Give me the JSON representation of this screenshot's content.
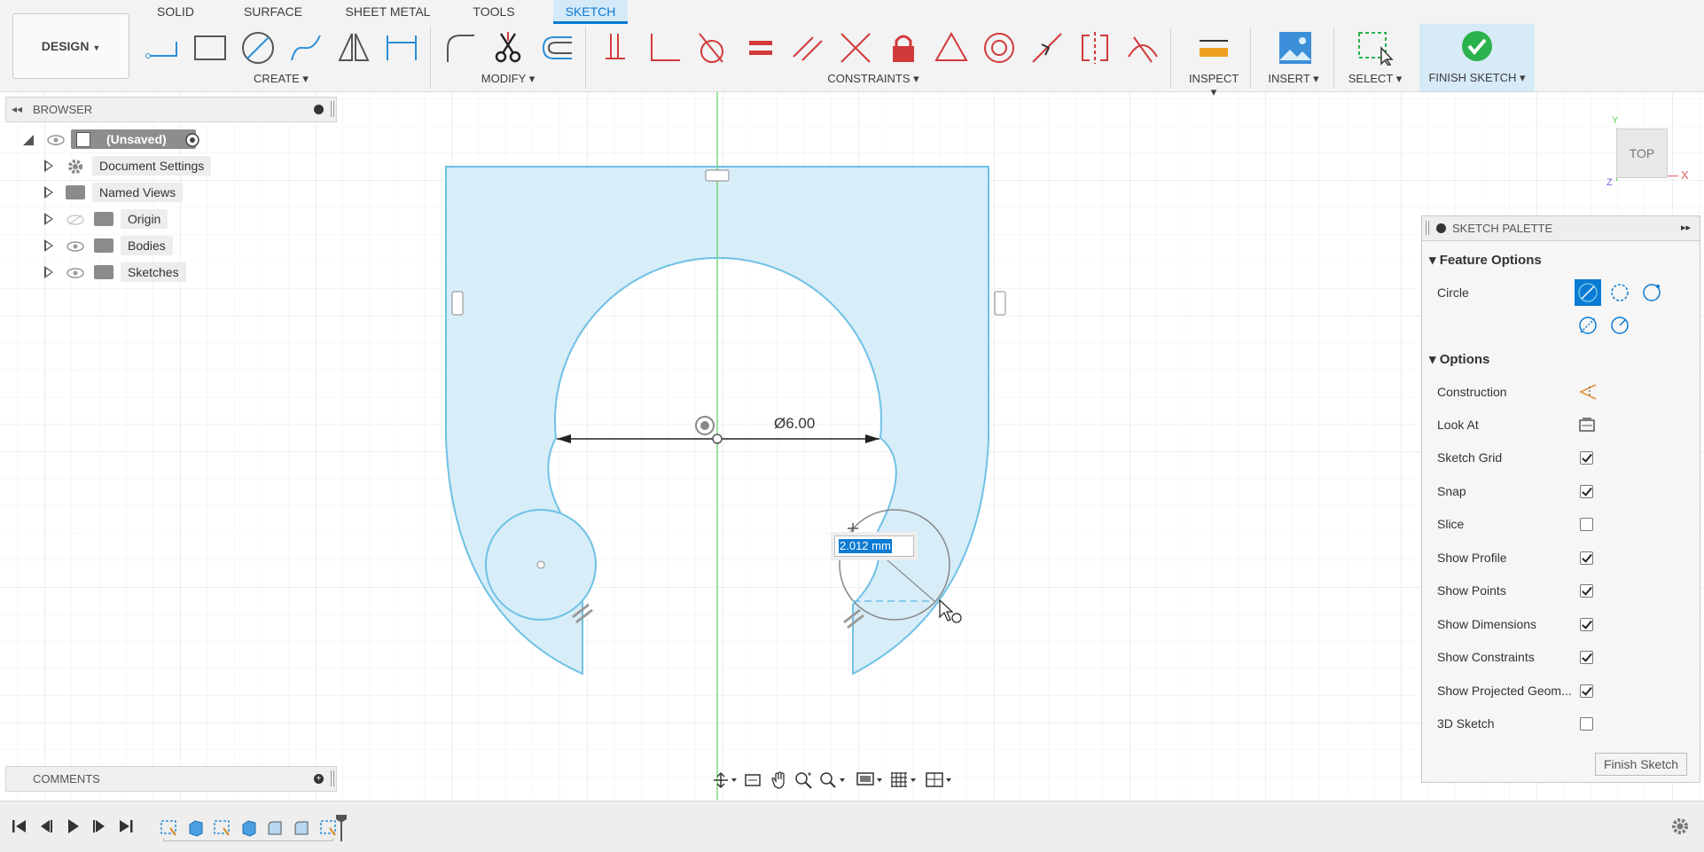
{
  "tabs": [
    "SOLID",
    "SURFACE",
    "SHEET METAL",
    "TOOLS",
    "SKETCH"
  ],
  "workspace_button": "DESIGN",
  "groups": {
    "create": "CREATE",
    "modify": "MODIFY",
    "constraints": "CONSTRAINTS",
    "inspect": "INSPECT",
    "insert": "INSERT",
    "select": "SELECT",
    "finish": "FINISH SKETCH"
  },
  "browser": {
    "title": "BROWSER",
    "root": "(Unsaved)",
    "items": [
      "Document Settings",
      "Named Views",
      "Origin",
      "Bodies",
      "Sketches"
    ]
  },
  "comments": {
    "title": "COMMENTS"
  },
  "viewcube": {
    "face": "TOP",
    "axis_x": "X",
    "axis_y": "Y",
    "axis_z": "Z"
  },
  "sketch": {
    "dimension_label": "Ø6.00",
    "input_value": "2.012 mm"
  },
  "palette": {
    "title": "SKETCH PALETTE",
    "feature_options": "Feature Options",
    "circle_label": "Circle",
    "options_title": "Options",
    "construction": "Construction",
    "look_at": "Look At",
    "checks": [
      {
        "label": "Sketch Grid",
        "checked": true
      },
      {
        "label": "Snap",
        "checked": true
      },
      {
        "label": "Slice",
        "checked": false
      },
      {
        "label": "Show Profile",
        "checked": true
      },
      {
        "label": "Show Points",
        "checked": true
      },
      {
        "label": "Show Dimensions",
        "checked": true
      },
      {
        "label": "Show Constraints",
        "checked": true
      },
      {
        "label": "Show Projected Geom...",
        "checked": true
      },
      {
        "label": "3D Sketch",
        "checked": false
      }
    ],
    "finish_button": "Finish Sketch"
  },
  "colors": {
    "accent": "#0b7bd3",
    "profile_fill": "#d7edf8",
    "sketch_line": "#6fc1e6",
    "constraint_red": "#d23a3a",
    "finish_green": "#2bb24c"
  }
}
